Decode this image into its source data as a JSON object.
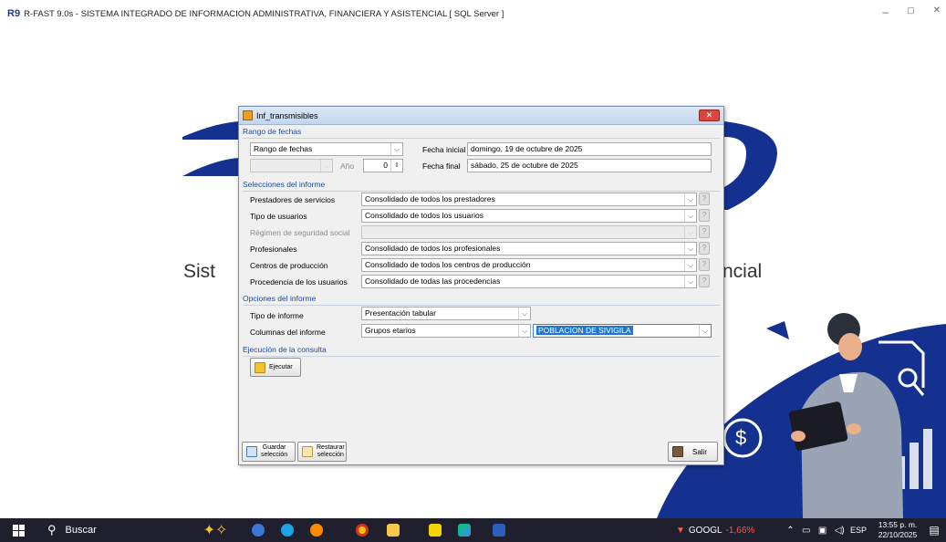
{
  "app": {
    "title": "R-FAST 9.0s - SISTEMA INTEGRADO DE INFORMACION ADMINISTRATIVA, FINANCIERA Y ASISTENCIAL [ SQL Server ]",
    "win_minimize": "–",
    "win_restore": "▢",
    "win_close": "✕"
  },
  "background": {
    "left_text": "Sist",
    "right_text": "ncial",
    "dollar": "$"
  },
  "dialog": {
    "title": "Inf_transmisibles",
    "close": "✕",
    "sections": {
      "dates": "Rango de fechas",
      "report_selections": "Selecciones del informe",
      "report_options": "Opciones del informe",
      "execution": "Ejecución de la consulta"
    },
    "dates": {
      "range_type_value": "Rango de fechas",
      "year_label": "Año",
      "year_value": "0",
      "start_label": "Fecha inicial",
      "start_value": "domingo, 19 de octubre de 2025",
      "end_label": "Fecha final",
      "end_value": "sábado, 25 de octubre de 2025"
    },
    "selections": [
      {
        "label": "Prestadores de servicios",
        "value": "Consolidado de todos los prestadores"
      },
      {
        "label": "Tipo de usuarios",
        "value": "Consolidado de todos los usuarios"
      },
      {
        "label": "Régimen de seguridad social",
        "value": ""
      },
      {
        "label": "Profesionales",
        "value": "Consolidado de todos los profesionales"
      },
      {
        "label": "Centros de producción",
        "value": "Consolidado de todos los centros de producción"
      },
      {
        "label": "Procedencia de los usuarios",
        "value": "Consolidado de todas las procedencias"
      }
    ],
    "options": {
      "report_type_label": "Tipo de informe",
      "report_type_value": "Presentación tabular",
      "columns_label": "Columnas del informe",
      "columns_value": "Grupos etarios",
      "population_value": "POBLACION DE SIVIGILA"
    },
    "buttons": {
      "run": "Ejecutar",
      "save_line1": "Guardar",
      "save_line2": "selección",
      "restore_line1": "Restaurar",
      "restore_line2": "selección",
      "exit": "Salir"
    }
  },
  "taskbar": {
    "search": "Buscar",
    "stock_name": "GOOGL",
    "stock_change": "-1,66%",
    "language": "ESP",
    "time": "13:55 p. m.",
    "date": "22/10/2025",
    "stock_color": "#ff5a4a"
  }
}
